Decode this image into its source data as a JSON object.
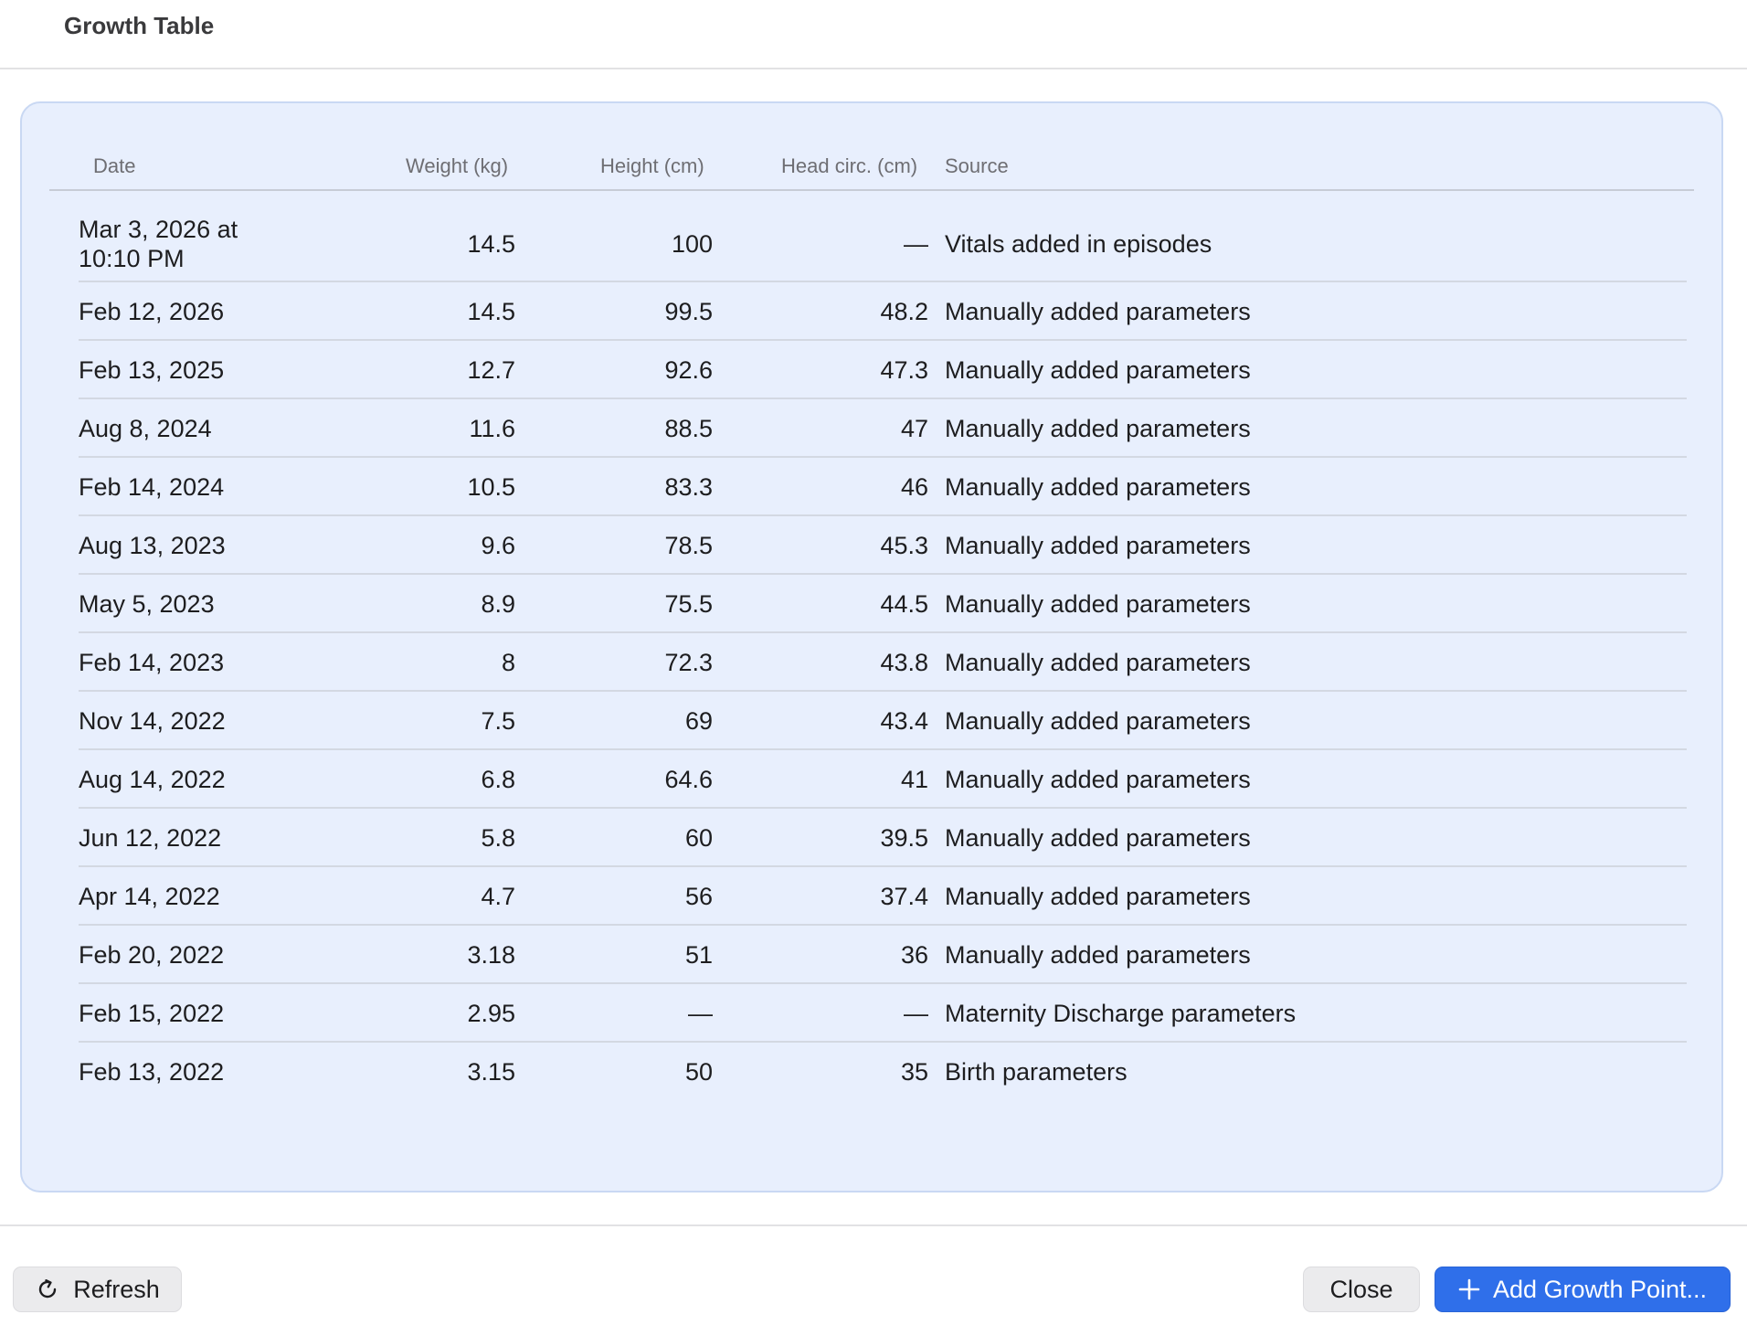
{
  "header": {
    "title": "Growth Table"
  },
  "table": {
    "columns": {
      "date": "Date",
      "weight": "Weight (kg)",
      "height": "Height (cm)",
      "head": "Head circ. (cm)",
      "source": "Source"
    },
    "rows": [
      {
        "date": "Mar 3, 2026 at",
        "date2": "10:10 PM",
        "weight": "14.5",
        "height": "100",
        "head": "—",
        "source": "Vitals added in episodes"
      },
      {
        "date": "Feb 12, 2026",
        "weight": "14.5",
        "height": "99.5",
        "head": "48.2",
        "source": "Manually added parameters"
      },
      {
        "date": "Feb 13, 2025",
        "weight": "12.7",
        "height": "92.6",
        "head": "47.3",
        "source": "Manually added parameters"
      },
      {
        "date": "Aug 8, 2024",
        "weight": "11.6",
        "height": "88.5",
        "head": "47",
        "source": "Manually added parameters"
      },
      {
        "date": "Feb 14, 2024",
        "weight": "10.5",
        "height": "83.3",
        "head": "46",
        "source": "Manually added parameters"
      },
      {
        "date": "Aug 13, 2023",
        "weight": "9.6",
        "height": "78.5",
        "head": "45.3",
        "source": "Manually added parameters"
      },
      {
        "date": "May 5, 2023",
        "weight": "8.9",
        "height": "75.5",
        "head": "44.5",
        "source": "Manually added parameters"
      },
      {
        "date": "Feb 14, 2023",
        "weight": "8",
        "height": "72.3",
        "head": "43.8",
        "source": "Manually added parameters"
      },
      {
        "date": "Nov 14, 2022",
        "weight": "7.5",
        "height": "69",
        "head": "43.4",
        "source": "Manually added parameters"
      },
      {
        "date": "Aug 14, 2022",
        "weight": "6.8",
        "height": "64.6",
        "head": "41",
        "source": "Manually added parameters"
      },
      {
        "date": "Jun 12, 2022",
        "weight": "5.8",
        "height": "60",
        "head": "39.5",
        "source": "Manually added parameters"
      },
      {
        "date": "Apr 14, 2022",
        "weight": "4.7",
        "height": "56",
        "head": "37.4",
        "source": "Manually added parameters"
      },
      {
        "date": "Feb 20, 2022",
        "weight": "3.18",
        "height": "51",
        "head": "36",
        "source": "Manually added parameters"
      },
      {
        "date": "Feb 15, 2022",
        "weight": "2.95",
        "height": "—",
        "head": "—",
        "source": "Maternity Discharge parameters"
      },
      {
        "date": "Feb 13, 2022",
        "weight": "3.15",
        "height": "50",
        "head": "35",
        "source": "Birth parameters"
      }
    ]
  },
  "footer": {
    "refresh_label": "Refresh",
    "refresh_icon": "refresh-icon",
    "close_label": "Close",
    "add_label": "Add Growth Point...",
    "add_icon": "plus-icon"
  },
  "colors": {
    "panel_bg": "#e8effd",
    "accent": "#2f6fea"
  }
}
